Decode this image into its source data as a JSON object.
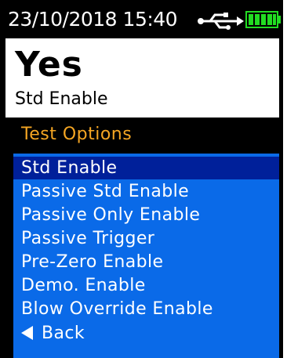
{
  "status_bar": {
    "datetime": "23/10/2018  15:40",
    "usb_icon": "usb-icon",
    "battery_icon": "battery-full-icon",
    "battery_color": "#22dd22"
  },
  "header": {
    "value": "Yes",
    "setting": "Std Enable"
  },
  "section": {
    "title": "Test Options",
    "title_color": "#f5a623"
  },
  "options": {
    "items": [
      {
        "label": "Std Enable",
        "selected": true
      },
      {
        "label": "Passive Std Enable",
        "selected": false
      },
      {
        "label": "Passive Only Enable",
        "selected": false
      },
      {
        "label": "Passive Trigger",
        "selected": false
      },
      {
        "label": "Pre-Zero Enable",
        "selected": false
      },
      {
        "label": "Demo. Enable",
        "selected": false
      },
      {
        "label": "Blow Override Enable",
        "selected": false
      }
    ],
    "back_label": "Back",
    "back_icon": "back-arrow-icon",
    "list_color": "#0a6ae8",
    "selected_color": "#00209a"
  }
}
